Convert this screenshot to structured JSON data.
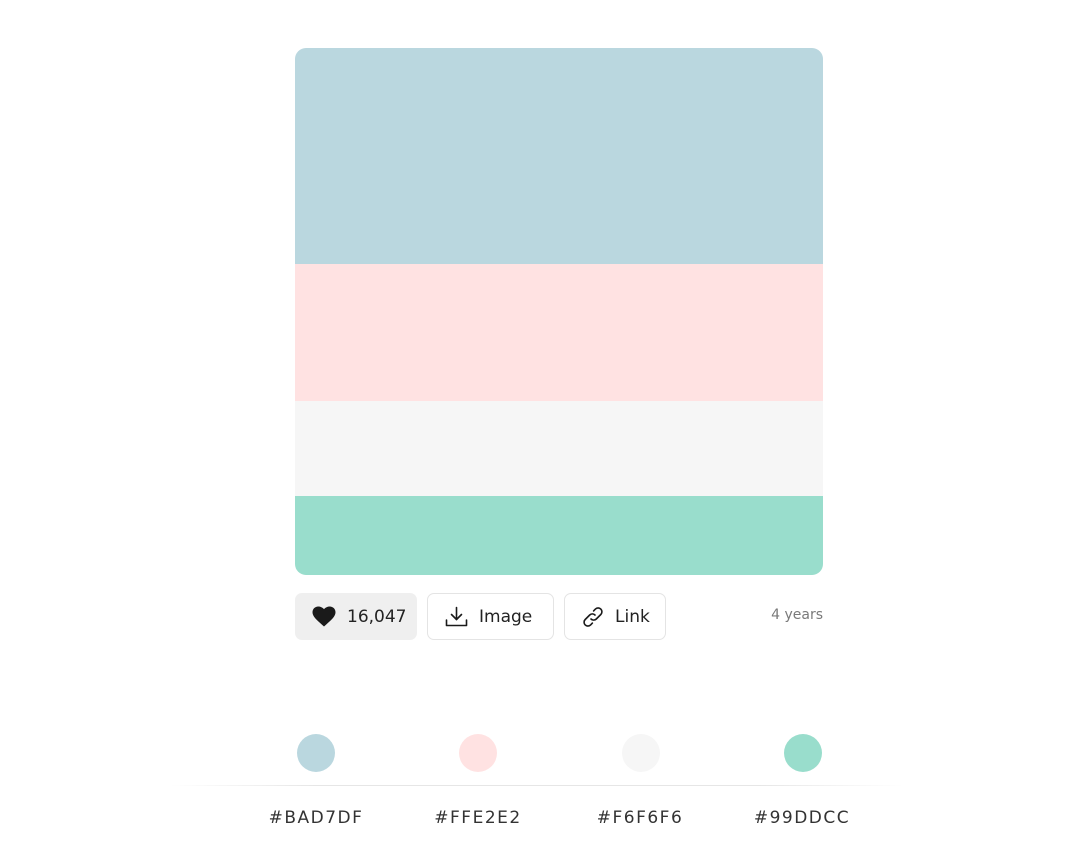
{
  "palette": {
    "colors": [
      "#BAD7DF",
      "#FFE2E2",
      "#F6F6F6",
      "#99DDCC"
    ],
    "hex_labels": [
      "#BAD7DF",
      "#FFE2E2",
      "#F6F6F6",
      "#99DDCC"
    ]
  },
  "actions": {
    "likes": "16,047",
    "image_label": "Image",
    "link_label": "Link"
  },
  "meta": {
    "age": "4 years"
  },
  "icons": {
    "like": "heart-icon",
    "image": "download-icon",
    "link": "link-icon"
  }
}
